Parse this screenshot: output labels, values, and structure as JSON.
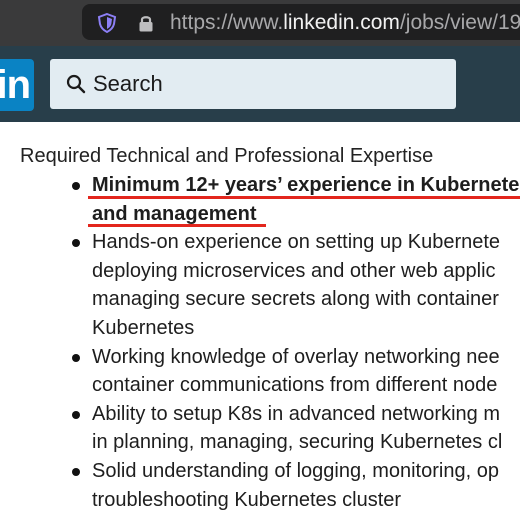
{
  "browser": {
    "url_prefix": "https://www.",
    "url_domain": "linkedin.com",
    "url_path": "/jobs/view/19",
    "shield_icon": "shield-icon",
    "lock_icon": "lock-icon"
  },
  "header": {
    "logo": "in",
    "search_label": "Search",
    "search_icon": "search-icon",
    "brand_color": "#283e4a",
    "logo_color": "#0a83c4"
  },
  "content": {
    "heading": "Required Technical and Professional Expertise",
    "highlight_color": "#e3261d",
    "bullets": [
      {
        "lines": [
          "Minimum 12+ years’ experience in Kubernete",
          "and management"
        ],
        "bold": true
      },
      {
        "lines": [
          "Hands-on experience on setting up Kubernete",
          "deploying microservices and other web applic",
          "managing secure secrets along with container",
          "Kubernetes"
        ]
      },
      {
        "lines": [
          "Working knowledge of overlay networking nee",
          "container communications from different node"
        ]
      },
      {
        "lines": [
          "Ability to setup K8s in advanced networking m",
          "in planning, managing, securing Kubernetes cl"
        ]
      },
      {
        "lines": [
          "Solid understanding of logging, monitoring, op",
          "troubleshooting Kubernetes cluster"
        ]
      }
    ]
  }
}
